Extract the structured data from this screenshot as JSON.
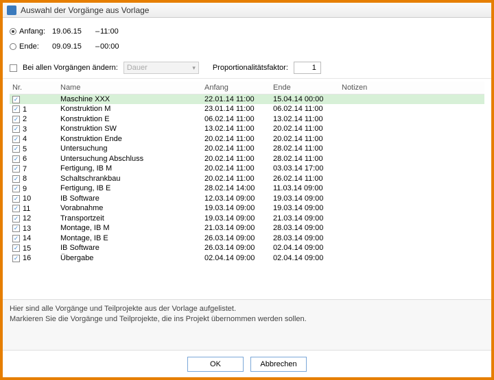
{
  "title": "Auswahl der Vorgänge aus Vorlage",
  "dates": {
    "start_label": "Anfang:",
    "start_date": "19.06.15",
    "start_time": "11:00",
    "end_label": "Ende:",
    "end_date": "09.09.15",
    "end_time": "00:00",
    "separator": "–"
  },
  "options": {
    "change_all_label": "Bei allen Vorgängen ändern:",
    "dropdown_value": "Dauer",
    "prop_label": "Proportionalitätsfaktor:",
    "prop_value": "1"
  },
  "columns": {
    "nr": "Nr.",
    "name": "Name",
    "start": "Anfang",
    "end": "Ende",
    "notes": "Notizen"
  },
  "rows": [
    {
      "nr": "",
      "name": "Maschine XXX",
      "start": "22.01.14 11:00",
      "end": "15.04.14 00:00",
      "highlight": true
    },
    {
      "nr": "1",
      "name": "Konstruktion M",
      "start": "23.01.14 11:00",
      "end": "06.02.14 11:00"
    },
    {
      "nr": "2",
      "name": "Konstruktion E",
      "start": "06.02.14 11:00",
      "end": "13.02.14 11:00"
    },
    {
      "nr": "3",
      "name": "Konstruktion SW",
      "start": "13.02.14 11:00",
      "end": "20.02.14 11:00"
    },
    {
      "nr": "4",
      "name": "Konstruktion Ende",
      "start": "20.02.14 11:00",
      "end": "20.02.14 11:00"
    },
    {
      "nr": "5",
      "name": "Untersuchung",
      "start": "20.02.14 11:00",
      "end": "28.02.14 11:00"
    },
    {
      "nr": "6",
      "name": "Untersuchung Abschluss",
      "start": "20.02.14 11:00",
      "end": "28.02.14 11:00"
    },
    {
      "nr": "7",
      "name": "Fertigung, IB M",
      "start": "20.02.14 11:00",
      "end": "03.03.14 17:00"
    },
    {
      "nr": "8",
      "name": "Schaltschrankbau",
      "start": "20.02.14 11:00",
      "end": "26.02.14 11:00"
    },
    {
      "nr": "9",
      "name": "Fertigung, IB E",
      "start": "28.02.14 14:00",
      "end": "11.03.14 09:00"
    },
    {
      "nr": "10",
      "name": "IB Software",
      "start": "12.03.14 09:00",
      "end": "19.03.14 09:00"
    },
    {
      "nr": "11",
      "name": "Vorabnahme",
      "start": "19.03.14 09:00",
      "end": "19.03.14 09:00"
    },
    {
      "nr": "12",
      "name": "Transportzeit",
      "start": "19.03.14 09:00",
      "end": "21.03.14 09:00"
    },
    {
      "nr": "13",
      "name": "Montage, IB M",
      "start": "21.03.14 09:00",
      "end": "28.03.14 09:00"
    },
    {
      "nr": "14",
      "name": "Montage, IB E",
      "start": "26.03.14 09:00",
      "end": "28.03.14 09:00"
    },
    {
      "nr": "15",
      "name": "IB Software",
      "start": "26.03.14 09:00",
      "end": "02.04.14 09:00"
    },
    {
      "nr": "16",
      "name": "Übergabe",
      "start": "02.04.14 09:00",
      "end": "02.04.14 09:00"
    }
  ],
  "hint": {
    "line1": "Hier sind alle Vorgänge und Teilprojekte aus der Vorlage aufgelistet.",
    "line2": "Markieren Sie die Vorgänge und Teilprojekte, die ins Projekt übernommen werden sollen."
  },
  "buttons": {
    "ok": "OK",
    "cancel": "Abbrechen"
  }
}
